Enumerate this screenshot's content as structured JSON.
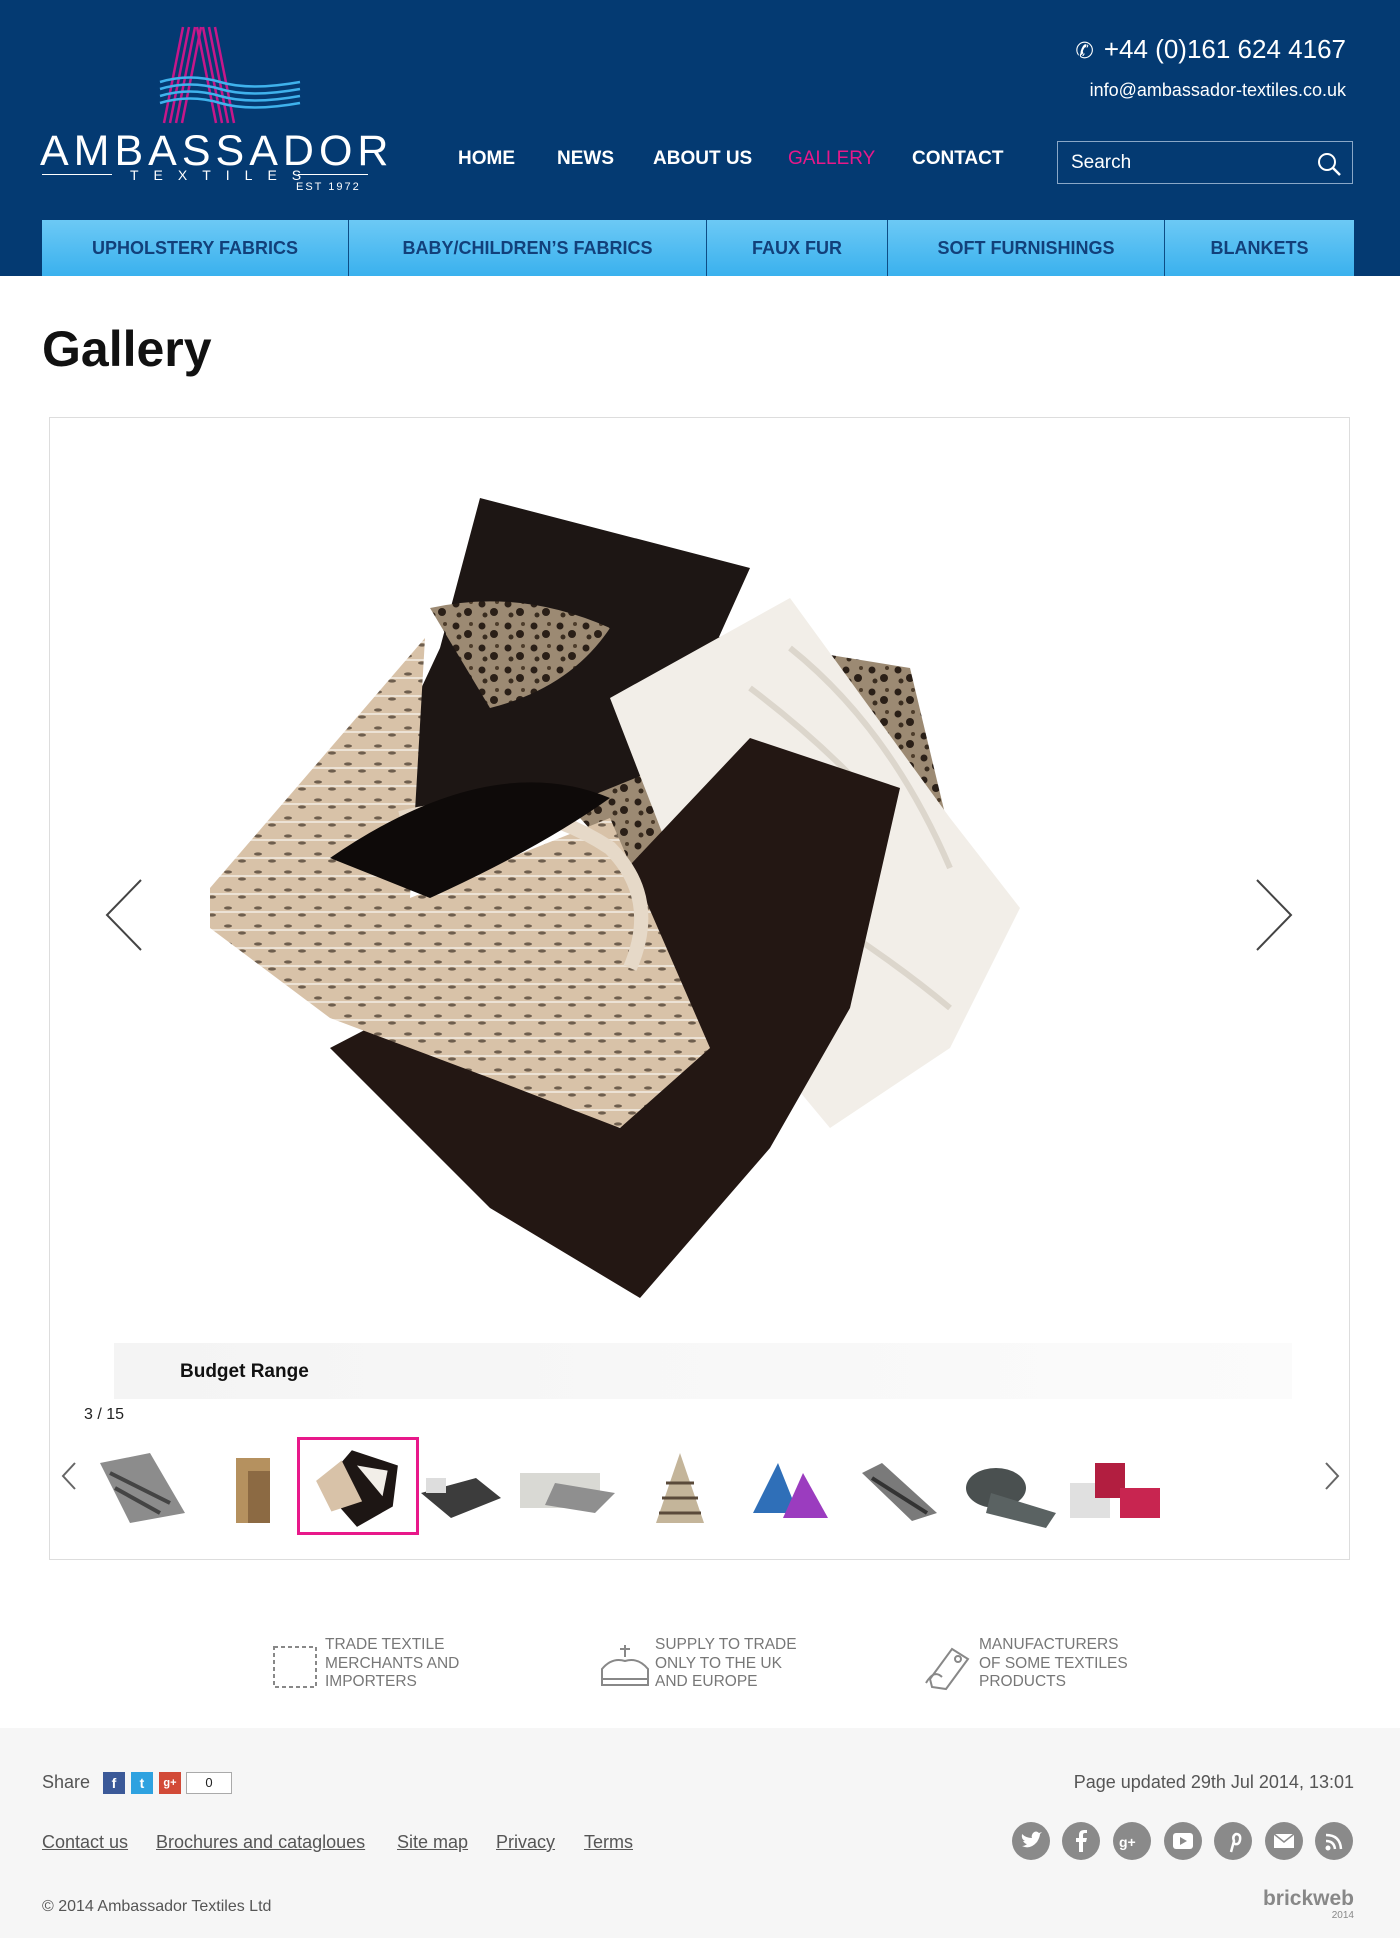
{
  "header": {
    "logo_name": "AMBASSADOR",
    "logo_sub": "TEXTILES",
    "logo_est": "EST 1972",
    "phone": "+44 (0)161 624 4167",
    "email": "info@ambassador-textiles.co.uk",
    "search_placeholder": "Search",
    "nav": [
      "HOME",
      "NEWS",
      "ABOUT US",
      "GALLERY",
      "CONTACT"
    ],
    "active_nav": "GALLERY",
    "categories": [
      "UPHOLSTERY FABRICS",
      "BABY/CHILDREN’S FABRICS",
      "FAUX FUR",
      "SOFT FURNISHINGS",
      "BLANKETS"
    ]
  },
  "page": {
    "title": "Gallery"
  },
  "gallery": {
    "caption": "Budget Range",
    "counter": "3 / 15",
    "selected_index": 2,
    "thumbnails": [
      "thumb-1",
      "thumb-2",
      "thumb-3",
      "thumb-4",
      "thumb-5",
      "thumb-6",
      "thumb-7",
      "thumb-8",
      "thumb-9",
      "thumb-10"
    ]
  },
  "features": [
    {
      "icon": "stamp-icon",
      "lines": [
        "TRADE TEXTILE",
        "MERCHANTS AND",
        "IMPORTERS"
      ]
    },
    {
      "icon": "crown-icon",
      "lines": [
        "SUPPLY TO TRADE",
        "ONLY TO THE UK",
        "AND EUROPE"
      ]
    },
    {
      "icon": "tag-icon",
      "lines": [
        "MANUFACTURERS",
        "OF SOME TEXTILES",
        "PRODUCTS"
      ]
    }
  ],
  "footer": {
    "share_label": "Share",
    "share_count": "0",
    "updated": "Page updated 29th Jul 2014, 13:01",
    "links": [
      "Contact us",
      "Brochures and catagloues",
      "Site map",
      "Privacy",
      "Terms"
    ],
    "copyright": "© 2014 Ambassador Textiles Ltd",
    "social": [
      "twitter-icon",
      "facebook-icon",
      "google-plus-icon",
      "youtube-icon",
      "pinterest-icon",
      "email-icon",
      "rss-icon"
    ],
    "credit": "brickweb",
    "credit_year": "2014"
  },
  "colors": {
    "header_bg": "#043a72",
    "accent": "#e8188a",
    "category_bar": "#3ab1ee"
  }
}
